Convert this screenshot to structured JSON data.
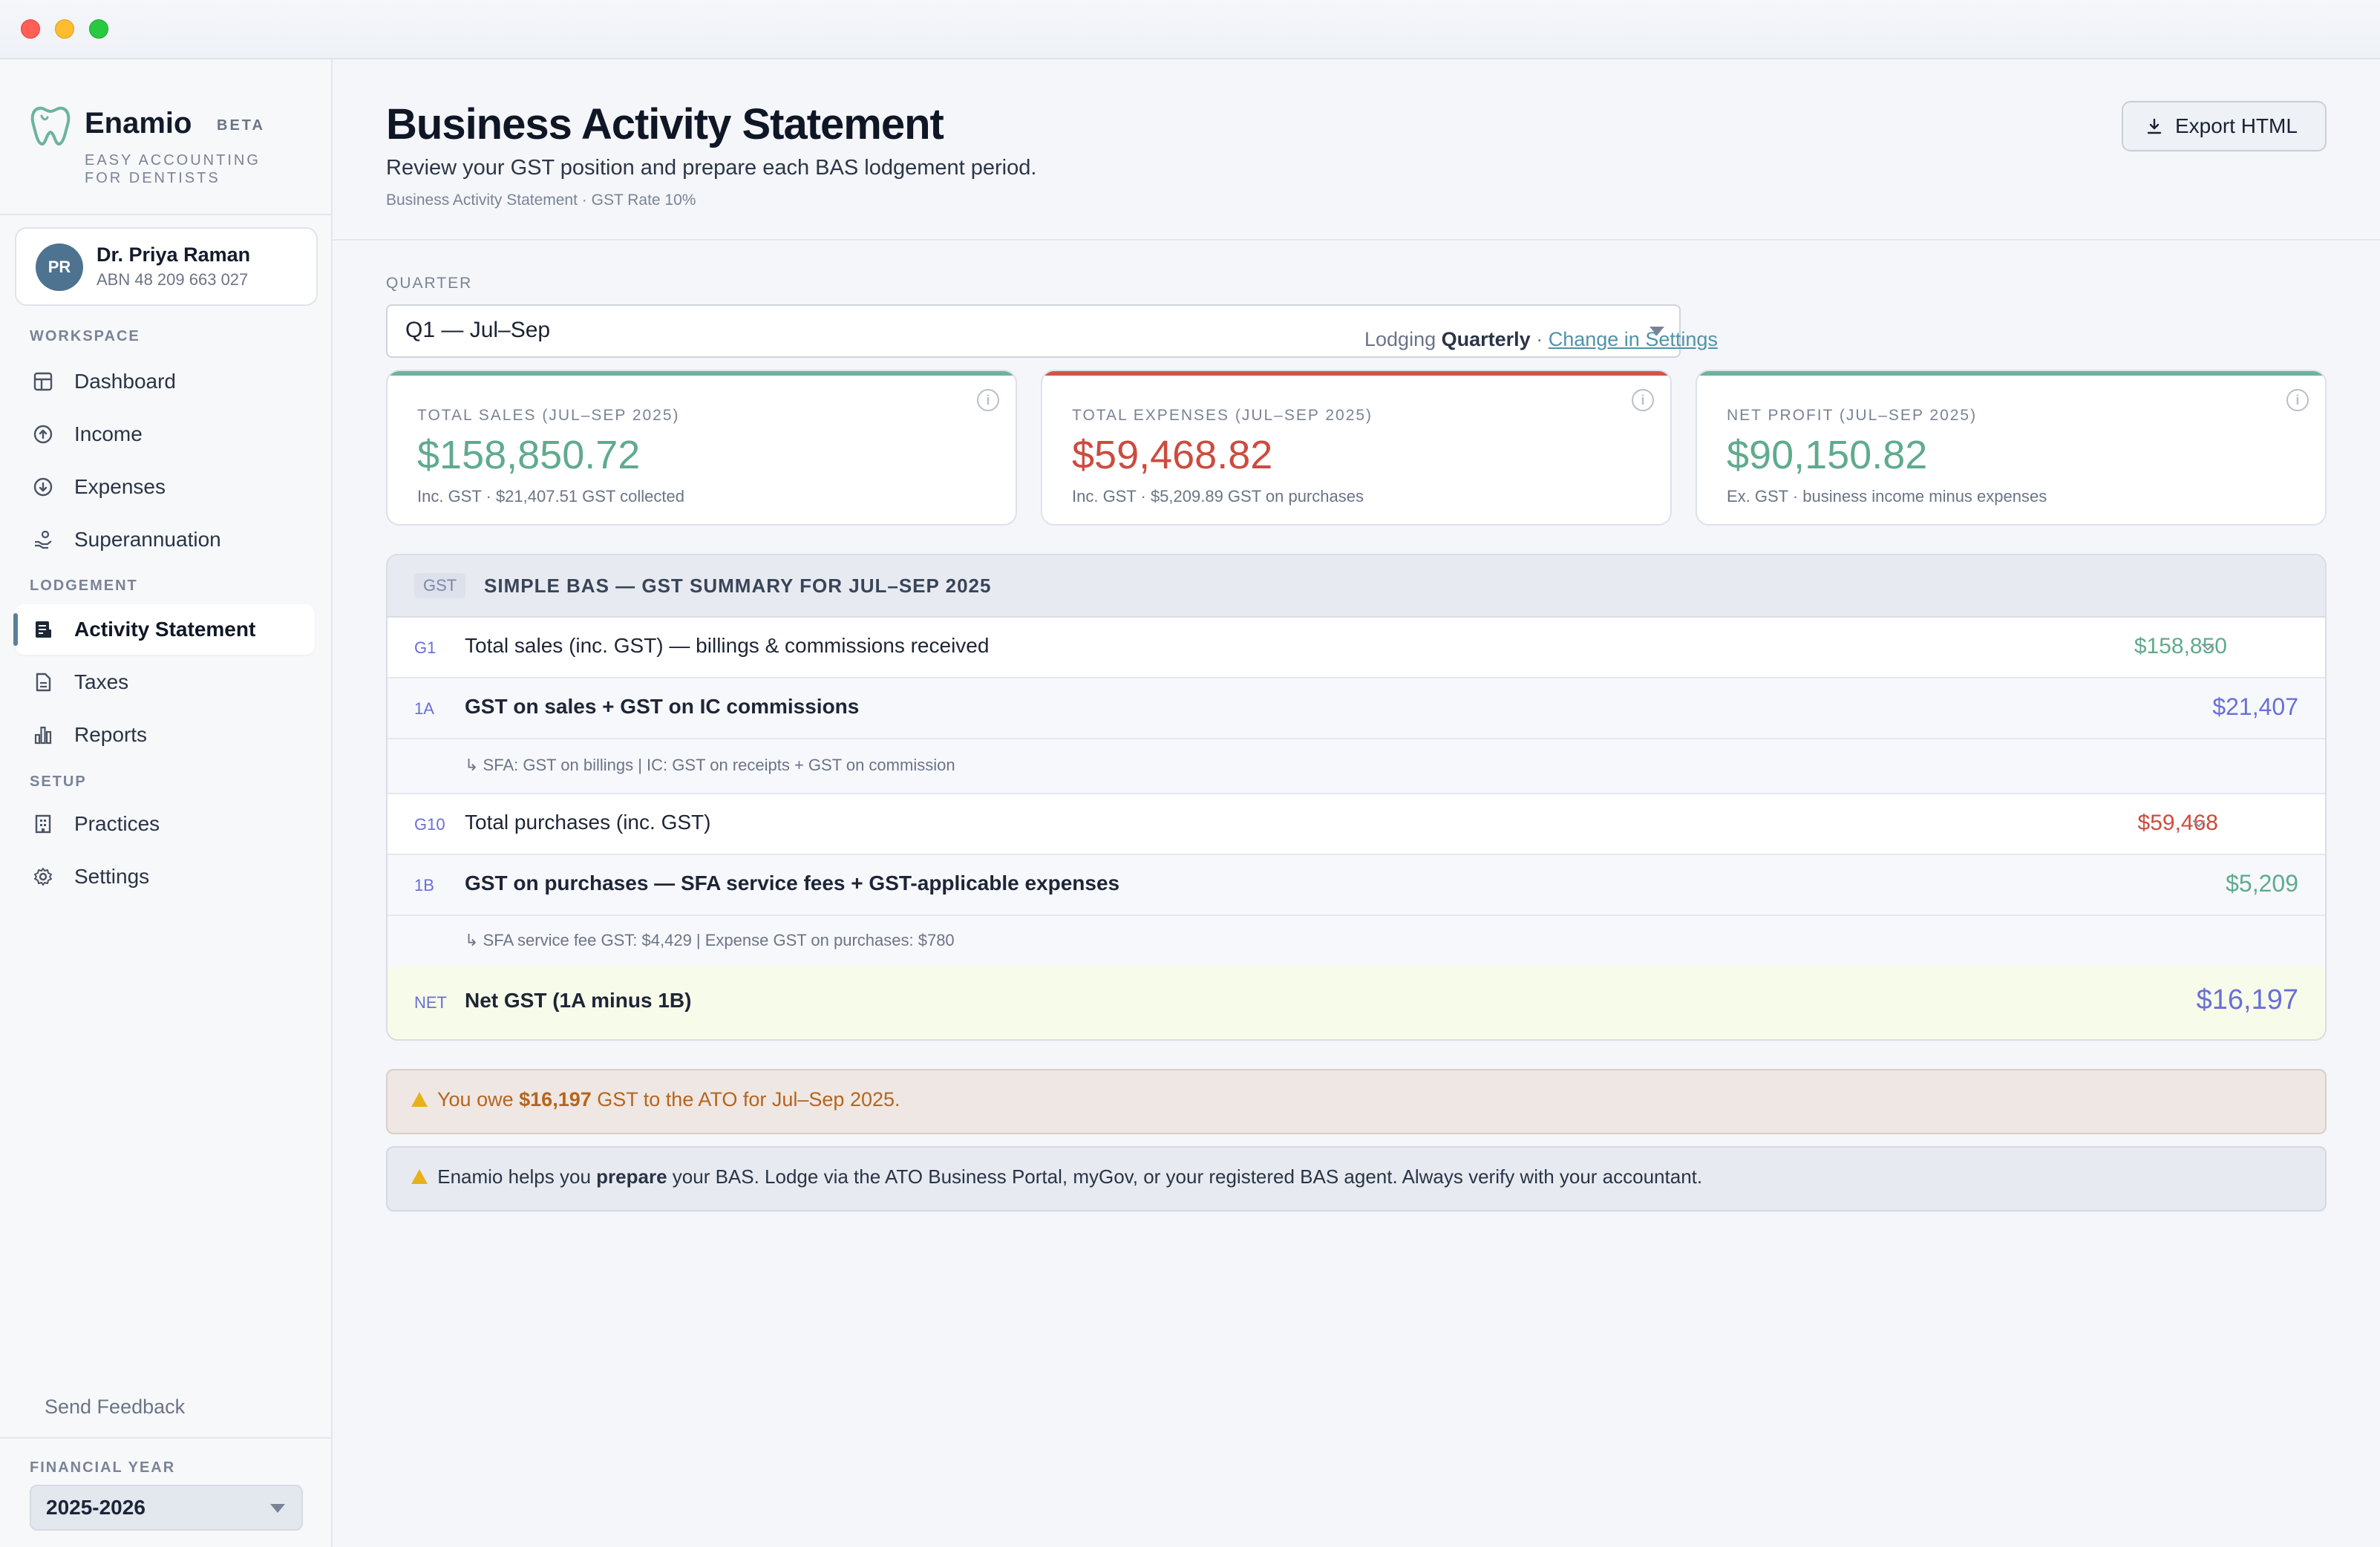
{
  "brand": {
    "name": "Enamio",
    "badge": "BETA",
    "tagline": "EASY ACCOUNTING FOR DENTISTS"
  },
  "user": {
    "initials": "PR",
    "name": "Dr. Priya Raman",
    "abn": "ABN 48 209 663 027"
  },
  "sidebar": {
    "sections": {
      "workspace": "WORKSPACE",
      "lodgement": "LODGEMENT",
      "setup": "SETUP"
    },
    "items": [
      {
        "label": "Dashboard",
        "icon": "grid-icon"
      },
      {
        "label": "Income",
        "icon": "arrow-up-circle-icon"
      },
      {
        "label": "Expenses",
        "icon": "arrow-down-circle-icon"
      },
      {
        "label": "Superannuation",
        "icon": "hand-coins-icon"
      },
      {
        "label": "Activity Statement",
        "icon": "document-list-icon",
        "active": true
      },
      {
        "label": "Taxes",
        "icon": "document-icon"
      },
      {
        "label": "Reports",
        "icon": "bar-chart-icon"
      },
      {
        "label": "Practices",
        "icon": "building-icon"
      },
      {
        "label": "Settings",
        "icon": "gear-icon"
      }
    ],
    "feedback": "Send Feedback",
    "financial_year_label": "FINANCIAL YEAR",
    "financial_year": "2025-2026"
  },
  "header": {
    "title": "Business Activity Statement",
    "subtitle": "Review your GST position and prepare each BAS lodgement period.",
    "meta": "Business Activity Statement · GST Rate 10%",
    "export_label": "Export HTML"
  },
  "quarter": {
    "label": "QUARTER",
    "selected": "Q1 — Jul–Sep",
    "lodging_prefix": "Lodging",
    "lodging_value": "Quarterly",
    "lodging_sep": "·",
    "lodging_link": "Change in Settings"
  },
  "cards": [
    {
      "label": "TOTAL SALES (JUL–SEP 2025)",
      "value": "$158,850.72",
      "note": "Inc. GST · $21,407.51 GST collected",
      "color": "#5fab8d"
    },
    {
      "label": "TOTAL EXPENSES (JUL–SEP 2025)",
      "value": "$59,468.82",
      "note": "Inc. GST · $5,209.89 GST on purchases",
      "color": "#cc4b3f"
    },
    {
      "label": "NET PROFIT (JUL–SEP 2025)",
      "value": "$90,150.82",
      "note": "Ex. GST · business income minus expenses",
      "color": "#5fab8d"
    }
  ],
  "bas": {
    "tag": "GST",
    "title": "SIMPLE BAS — GST SUMMARY FOR JUL–SEP 2025",
    "rows": [
      {
        "code": "G1",
        "desc": "Total sales (inc. GST) — billings & commissions received",
        "amount": "$158,850"
      },
      {
        "code": "1A",
        "desc": "GST on sales + GST on IC commissions",
        "amount": "$21,407",
        "sub": "↳ SFA: GST on billings  |  IC: GST on receipts + GST on commission"
      },
      {
        "code": "G10",
        "desc": "Total purchases (inc. GST)",
        "amount": "$59,468"
      },
      {
        "code": "1B",
        "desc": "GST on purchases — SFA service fees + GST-applicable expenses",
        "amount": "$5,209",
        "sub": "↳ SFA service fee GST: $4,429  |  Expense GST on purchases: $780"
      },
      {
        "code": "NET",
        "desc": "Net GST (1A minus 1B)",
        "amount": "$16,197"
      }
    ]
  },
  "alerts": {
    "owe_prefix": "You owe",
    "owe_amount": "$16,197",
    "owe_suffix": "GST to the ATO for Jul–Sep 2025.",
    "info_prefix": "Enamio helps you",
    "info_bold": "prepare",
    "info_suffix": "your BAS. Lodge via the ATO Business Portal, myGov, or your registered BAS agent. Always verify with your accountant."
  },
  "colors": {
    "green": "#5fab8d",
    "red": "#cc4b3f",
    "purple": "#6a6fd6",
    "net_bg": "#f7fbe9"
  }
}
